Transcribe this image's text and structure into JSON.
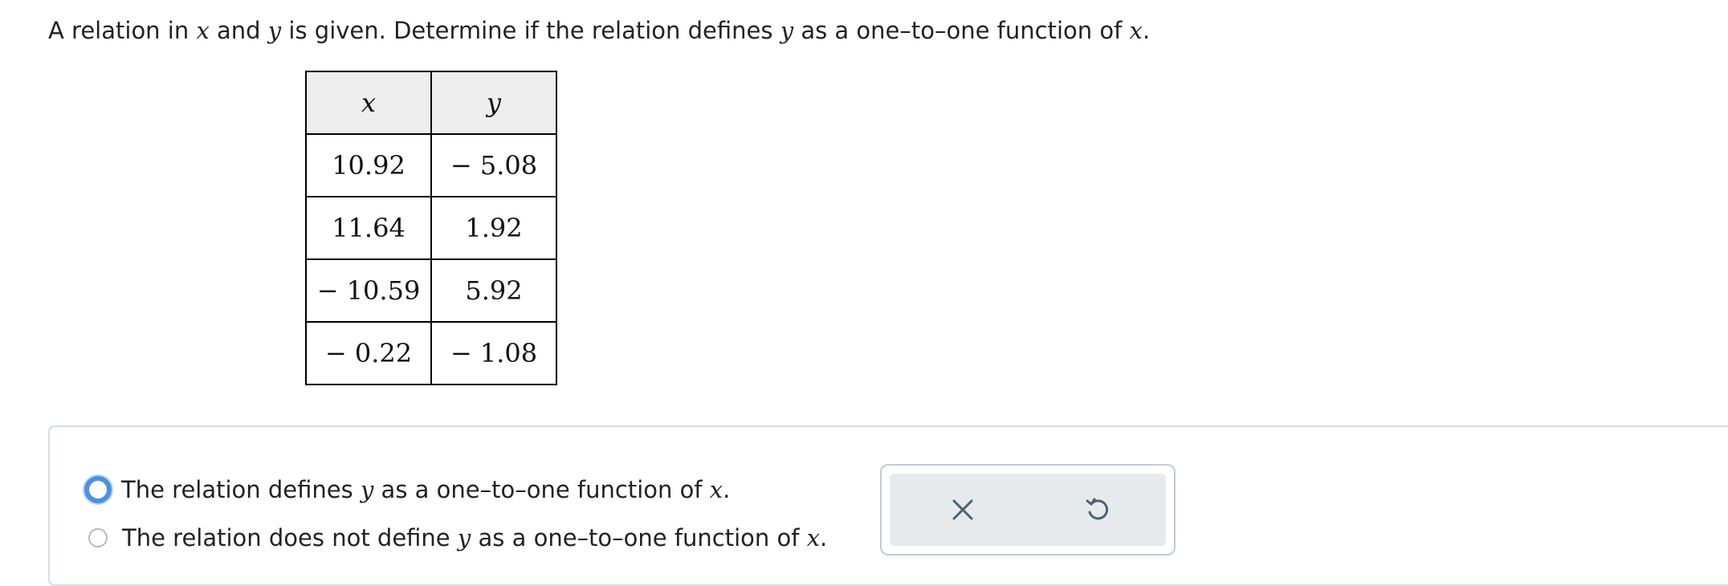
{
  "question": {
    "p1": "A relation in ",
    "v1": "x",
    "p2": " and ",
    "v2": "y",
    "p3": " is given. Determine if the relation defines ",
    "v3": "y",
    "p4": " as a one–to–one function of ",
    "v4": "x",
    "p5": "."
  },
  "table": {
    "headers": [
      "x",
      "y"
    ],
    "rows": [
      [
        "10.92",
        "− 5.08"
      ],
      [
        "11.64",
        "1.92"
      ],
      [
        "− 10.59",
        "5.92"
      ],
      [
        "− 0.22",
        "− 1.08"
      ]
    ]
  },
  "options": [
    {
      "p1": "The relation defines ",
      "v1": "y",
      "p2": " as a one–to–one function of ",
      "v2": "x",
      "p3": "."
    },
    {
      "p1": "The relation does not define ",
      "v1": "y",
      "p2": " as a one–to–one function of ",
      "v2": "x",
      "p3": "."
    }
  ],
  "actions": {
    "clear_icon": "x-icon",
    "undo_icon": "undo-icon",
    "icon_color": "#4a6470"
  },
  "colors": {
    "radio_focus": "#4a90e2",
    "table_header_bg": "#eeeeee",
    "action_bg": "#e6eaed"
  }
}
